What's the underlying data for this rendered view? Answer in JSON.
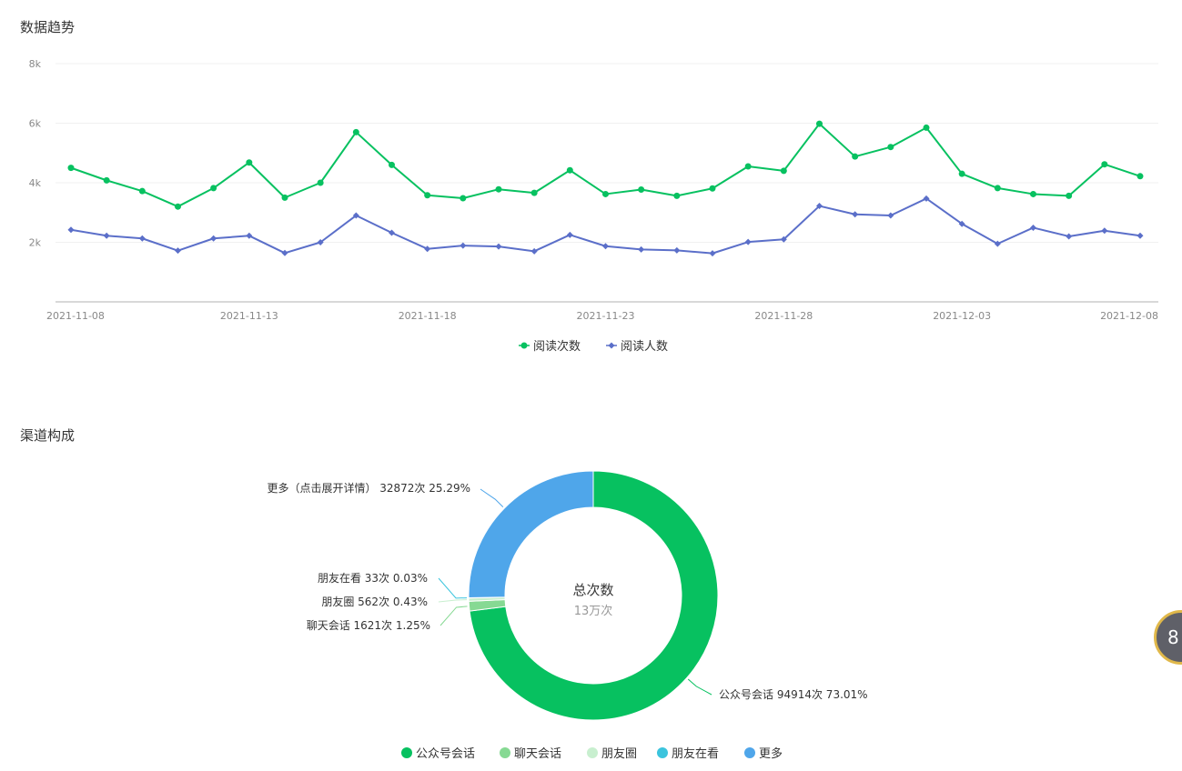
{
  "trend": {
    "title": "数据趋势"
  },
  "channel": {
    "title": "渠道构成"
  },
  "float_widget": {
    "text": "8"
  },
  "chart_data": [
    {
      "type": "line",
      "y_ticks": [
        "2k",
        "4k",
        "6k",
        "8k"
      ],
      "ylim": [
        0,
        8000
      ],
      "x_ticks": [
        "2021-11-08",
        "2021-11-13",
        "2021-11-18",
        "2021-11-23",
        "2021-11-28",
        "2021-12-03",
        "2021-12-08"
      ],
      "x": [
        "2021-11-08",
        "2021-11-09",
        "2021-11-10",
        "2021-11-11",
        "2021-11-12",
        "2021-11-13",
        "2021-11-14",
        "2021-11-15",
        "2021-11-16",
        "2021-11-17",
        "2021-11-18",
        "2021-11-19",
        "2021-11-20",
        "2021-11-21",
        "2021-11-22",
        "2021-11-23",
        "2021-11-24",
        "2021-11-25",
        "2021-11-26",
        "2021-11-27",
        "2021-11-28",
        "2021-11-29",
        "2021-11-30",
        "2021-12-01",
        "2021-12-02",
        "2021-12-03",
        "2021-12-04",
        "2021-12-05",
        "2021-12-06",
        "2021-12-07",
        "2021-12-08"
      ],
      "grid": true,
      "legend_position": "bottom-center",
      "series": [
        {
          "name": "阅读次数",
          "color": "#07c160",
          "marker": "circle",
          "values": [
            4500,
            4080,
            3720,
            3200,
            3820,
            4680,
            3500,
            4000,
            5700,
            4600,
            3580,
            3480,
            3780,
            3660,
            4420,
            3620,
            3770,
            3560,
            3810,
            4550,
            4400,
            5980,
            4880,
            5200,
            5850,
            4300,
            3820,
            3620,
            3560,
            4620,
            4220
          ]
        },
        {
          "name": "阅读人数",
          "color": "#5b6fc9",
          "marker": "diamond",
          "values": [
            2420,
            2220,
            2130,
            1720,
            2130,
            2220,
            1640,
            2000,
            2900,
            2320,
            1780,
            1890,
            1860,
            1700,
            2250,
            1870,
            1760,
            1730,
            1630,
            2010,
            2100,
            3220,
            2940,
            2900,
            3470,
            2620,
            1950,
            2490,
            2200,
            2390,
            2220
          ]
        }
      ]
    },
    {
      "type": "pie",
      "variant": "donut",
      "center_title": "总次数",
      "center_value": "13万次",
      "legend_position": "bottom-center",
      "slices": [
        {
          "name": "公众号会话",
          "count": 94914,
          "percent": 73.01,
          "label": "公众号会话 94914次 73.01%",
          "color": "#07c160"
        },
        {
          "name": "聊天会话",
          "count": 1621,
          "percent": 1.25,
          "label": "聊天会话 1621次 1.25%",
          "color": "#86d993"
        },
        {
          "name": "朋友圈",
          "count": 562,
          "percent": 0.43,
          "label": "朋友圈 562次 0.43%",
          "color": "#c8efcf"
        },
        {
          "name": "朋友在看",
          "count": 33,
          "percent": 0.03,
          "label": "朋友在看 33次 0.03%",
          "color": "#3bc4dd"
        },
        {
          "name": "更多",
          "count": 32872,
          "percent": 25.29,
          "label": "更多（点击展开详情） 32872次 25.29%",
          "color": "#4fa6ea"
        }
      ]
    }
  ]
}
